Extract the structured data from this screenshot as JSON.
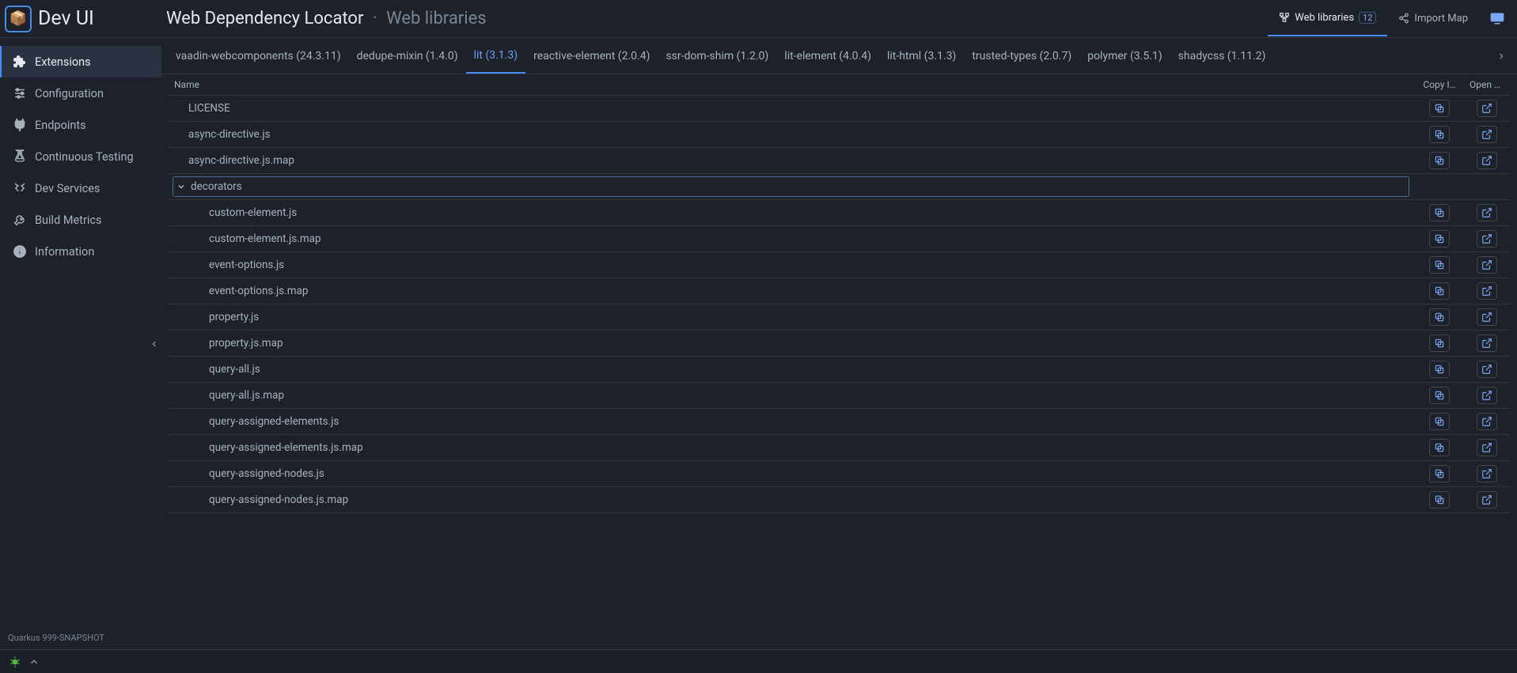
{
  "header": {
    "app_name": "Dev UI",
    "title": "Web Dependency Locator",
    "subtitle": "Web libraries",
    "right_tabs": [
      {
        "label": "Web libraries",
        "badge": "12",
        "active": true
      },
      {
        "label": "Import Map",
        "badge": null,
        "active": false
      }
    ]
  },
  "sidebar": {
    "items": [
      {
        "id": "extensions",
        "label": "Extensions",
        "active": true
      },
      {
        "id": "configuration",
        "label": "Configuration",
        "active": false
      },
      {
        "id": "endpoints",
        "label": "Endpoints",
        "active": false
      },
      {
        "id": "continuous-testing",
        "label": "Continuous Testing",
        "active": false
      },
      {
        "id": "dev-services",
        "label": "Dev Services",
        "active": false
      },
      {
        "id": "build-metrics",
        "label": "Build Metrics",
        "active": false
      },
      {
        "id": "information",
        "label": "Information",
        "active": false
      }
    ],
    "version": "Quarkus 999-SNAPSHOT"
  },
  "libraries": {
    "tabs": [
      {
        "label": "vaadin-webcomponents (24.3.11)",
        "active": false
      },
      {
        "label": "dedupe-mixin (1.4.0)",
        "active": false
      },
      {
        "label": "lit (3.1.3)",
        "active": true
      },
      {
        "label": "reactive-element (2.0.4)",
        "active": false
      },
      {
        "label": "ssr-dom-shim (1.2.0)",
        "active": false
      },
      {
        "label": "lit-element (4.0.4)",
        "active": false
      },
      {
        "label": "lit-html (3.1.3)",
        "active": false
      },
      {
        "label": "trusted-types (2.0.7)",
        "active": false
      },
      {
        "label": "polymer (3.5.1)",
        "active": false
      },
      {
        "label": "shadycss (1.11.2)",
        "active": false
      }
    ]
  },
  "table": {
    "columns": {
      "name": "Name",
      "copy": "Copy I…",
      "open": "Open as…"
    },
    "rows": [
      {
        "name": "LICENSE",
        "type": "file",
        "indent": 0
      },
      {
        "name": "async-directive.js",
        "type": "file",
        "indent": 0
      },
      {
        "name": "async-directive.js.map",
        "type": "file",
        "indent": 0
      },
      {
        "name": "decorators",
        "type": "folder",
        "indent": 0,
        "expanded": true
      },
      {
        "name": "custom-element.js",
        "type": "file",
        "indent": 1
      },
      {
        "name": "custom-element.js.map",
        "type": "file",
        "indent": 1
      },
      {
        "name": "event-options.js",
        "type": "file",
        "indent": 1
      },
      {
        "name": "event-options.js.map",
        "type": "file",
        "indent": 1
      },
      {
        "name": "property.js",
        "type": "file",
        "indent": 1
      },
      {
        "name": "property.js.map",
        "type": "file",
        "indent": 1
      },
      {
        "name": "query-all.js",
        "type": "file",
        "indent": 1
      },
      {
        "name": "query-all.js.map",
        "type": "file",
        "indent": 1
      },
      {
        "name": "query-assigned-elements.js",
        "type": "file",
        "indent": 1
      },
      {
        "name": "query-assigned-elements.js.map",
        "type": "file",
        "indent": 1
      },
      {
        "name": "query-assigned-nodes.js",
        "type": "file",
        "indent": 1
      },
      {
        "name": "query-assigned-nodes.js.map",
        "type": "file",
        "indent": 1
      }
    ]
  }
}
